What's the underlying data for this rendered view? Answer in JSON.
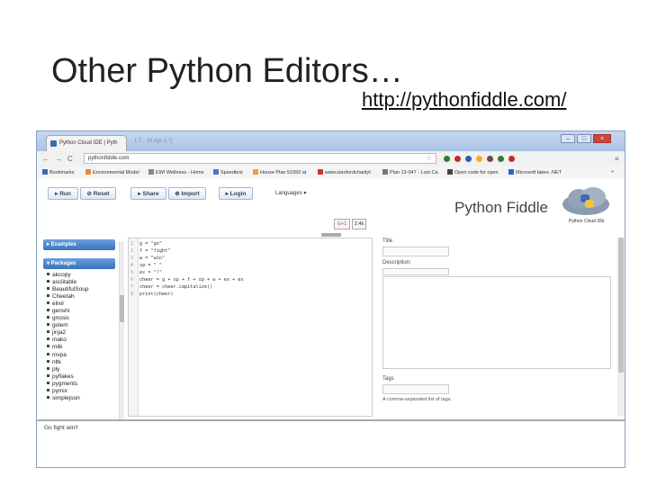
{
  "slide": {
    "title": "Other Python Editors…",
    "url": "http://pythonfiddle.com/"
  },
  "browser": {
    "tab_title": "Python Cloud IDE | Pyth",
    "tab_close": "×",
    "faint_tab": "1:7  ·  19 Apr 1:7)",
    "window_controls": [
      "–",
      "□",
      "×"
    ],
    "address": "pythonfiddle.com",
    "back": "←",
    "forward": "→",
    "reload": "C",
    "star": "☆",
    "ext_colors": [
      "#2e7d32",
      "#c62828",
      "#1565c0",
      "#f9a825",
      "#6d4c41",
      "#2e7d32",
      "#c62828"
    ],
    "menu": "≡",
    "bookmarks_overflow": "»",
    "bookmarks": [
      {
        "label": "Bookmarks",
        "color": "#3b6db3"
      },
      {
        "label": "Environmental Model",
        "color": "#e6883a"
      },
      {
        "label": "EWI Wellness - Home",
        "color": "#888888"
      },
      {
        "label": "Speedtest",
        "color": "#4a78c2"
      },
      {
        "label": "House Plan 51550 at",
        "color": "#d9a83a"
      },
      {
        "label": "www.stanfordcharityt",
        "color": "#c33"
      },
      {
        "label": "Plan 12-047 - Lost Ca",
        "color": "#777777"
      },
      {
        "label": "Open code for open",
        "color": "#444444"
      },
      {
        "label": "Microsoft takes .NET",
        "color": "#2a66c0"
      }
    ]
  },
  "app": {
    "toolbar": {
      "run": "▸ Run",
      "reset": "⊘ Reset",
      "share": "▸ Share",
      "import": "⊕ Import",
      "login": "▸ Login"
    },
    "languages": "Languages ▾",
    "logo": "Python Fiddle",
    "logo_sub": "Python Cloud IDE",
    "gplus": "G+1",
    "gplus_count": "2.4k"
  },
  "sidebar": {
    "examples": "▸ Examples",
    "packages": "▾ Packages",
    "packages_list": [
      "akcopy",
      "asciitable",
      "BeautifulSoup",
      "Cheetah",
      "elixir",
      "genshi",
      "gnosis",
      "golem",
      "jinja2",
      "mako",
      "milk",
      "mvpa",
      "nltk",
      "ply",
      "pyflakes",
      "pygments",
      "pymix",
      "simplejson"
    ]
  },
  "editor": {
    "line_numbers": [
      "1",
      "2",
      "3",
      "4",
      "5",
      "6",
      "7",
      "8"
    ],
    "lines": [
      "g = \"go\"",
      "f = \"fight\"",
      "w = \"win\"",
      "sp = \" \"",
      "ex = \"!\"",
      "cheer = g + sp + f + sp + w + ex + ex",
      "cheer = cheer.capitalize()",
      "print(cheer)"
    ]
  },
  "meta": {
    "title_label": "Title",
    "description_label": "Description:",
    "tags_label": "Tags",
    "tags_hint": "A comma-separated list of tags."
  },
  "console": {
    "output": "Go fight win!!"
  }
}
